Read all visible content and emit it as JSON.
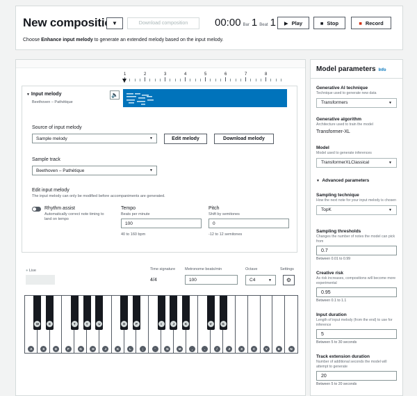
{
  "header": {
    "title": "New composition",
    "download_label": "Download composition",
    "time": "00:00",
    "bar_label": "Bar",
    "bar_value": "1",
    "beat_label": "Beat",
    "beat_value": "1",
    "play_label": "Play",
    "stop_label": "Stop",
    "record_label": "Record",
    "subtitle_prefix": "Choose ",
    "subtitle_bold": "Enhance input melody",
    "subtitle_suffix": " to generate an extended melody based on the input melody."
  },
  "ruler": [
    "1",
    "2",
    "3",
    "4",
    "5",
    "6",
    "7",
    "8"
  ],
  "track": {
    "name": "Input melody",
    "subtitle": "Beethoven – Pathétique"
  },
  "source": {
    "label": "Source of input melody",
    "value": "Sample melody",
    "edit_button": "Edit melody",
    "download_button": "Download melody"
  },
  "sample": {
    "label": "Sample track",
    "value": "Beethoven – Pathétique"
  },
  "edit": {
    "label": "Edit input melody",
    "desc": "The input melody can only be modified before accompaniments are generated."
  },
  "rhythm": {
    "label": "Rhythm assist",
    "desc": "Automatically correct note timing to land on tempo"
  },
  "tempo": {
    "label": "Tempo",
    "desc": "Beats per minute",
    "value": "100",
    "hint": "40 to 160 bpm"
  },
  "pitch": {
    "label": "Pitch",
    "desc": "Shift by semitones",
    "value": "0",
    "hint": "-12 to 12 semitones"
  },
  "keyboard_controls": {
    "live_label": "Live",
    "time_sig_label": "Time signature",
    "time_sig_value": "4/4",
    "metronome_label": "Metronome beats/min",
    "metronome_value": "100",
    "octave_label": "Octave",
    "octave_value": "C4",
    "settings_label": "Settings"
  },
  "piano": {
    "white_keys": [
      "A",
      "S",
      "D",
      "F",
      "G",
      "H",
      "J",
      "K",
      "L",
      ";",
      "'",
      "N",
      "M",
      ",",
      ".",
      "/",
      "Z",
      "X",
      "C",
      "V",
      "B",
      "N"
    ],
    "black_keys": [
      "W",
      "E",
      "T",
      "Y",
      "U",
      "O",
      "P",
      "I",
      "J",
      "K",
      "V",
      "G"
    ]
  },
  "model_params": {
    "title": "Model parameters",
    "info": "Info",
    "technique_label": "Generative AI technique",
    "technique_desc": "Technique used to generate new data",
    "technique_value": "Transformers",
    "algorithm_label": "Generative algorithm",
    "algorithm_desc": "Architecture used to train the model",
    "algorithm_value": "Transformer-XL",
    "model_label": "Model",
    "model_desc": "Model used to generate inferences",
    "model_value": "TransformerXLClassical",
    "advanced_label": "Advanced parameters",
    "sampling_label": "Sampling technique",
    "sampling_desc": "How the next note for your input melody is chosen",
    "sampling_value": "TopK",
    "thresholds_label": "Sampling thresholds",
    "thresholds_desc": "Changes the number of notes the model can pick from",
    "thresholds_value": "0.7",
    "thresholds_hint": "Between 0.01 to 0.99",
    "risk_label": "Creative risk",
    "risk_desc": "As risk increases, compositions will become more experimental",
    "risk_value": "0.95",
    "risk_hint": "Between 0.1 to 1.1",
    "duration_label": "Input duration",
    "duration_desc": "Length of input melody (from the end) to use for inference",
    "duration_value": "5",
    "duration_hint": "Between 5 to 30 seconds",
    "extension_label": "Track extension duration",
    "extension_desc": "Number of additional seconds the model will attempt to generate",
    "extension_value": "20",
    "extension_hint": "Between 5 to 20 seconds"
  },
  "colors": {
    "track_blue": "#0073bb",
    "record_red": "#d13212"
  }
}
